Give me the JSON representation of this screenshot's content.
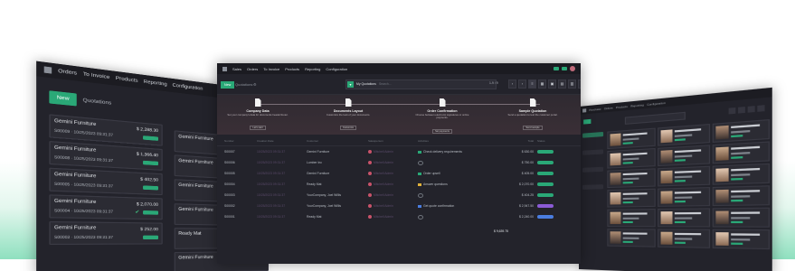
{
  "left": {
    "menu": [
      "Orders",
      "To Invoice",
      "Products",
      "Reporting",
      "Configuration"
    ],
    "new_label": "New",
    "title": "Quotations",
    "cards_col1": [
      {
        "name": "Gemini Furniture",
        "amount": "$ 2,288.30",
        "date": "S00009 · 10/25/2023 09:31:37",
        "badge": true,
        "check": false
      },
      {
        "name": "Gemini Furniture",
        "amount": "$ 1,366.40",
        "date": "S00008 · 10/25/2023 09:31:37",
        "badge": true,
        "check": false
      },
      {
        "name": "Gemini Furniture",
        "amount": "$ 402.50",
        "date": "S00005 · 10/25/2023 09:31:37",
        "badge": true,
        "check": false
      },
      {
        "name": "Gemini Furniture",
        "amount": "$ 2,070.00",
        "date": "S00004 · 10/25/2023 09:31:37",
        "badge": true,
        "check": true
      },
      {
        "name": "Gemini Furniture",
        "amount": "$ 252.00",
        "date": "S00003 · 10/25/2023 09:31:37",
        "badge": true,
        "check": false
      }
    ],
    "cards_col2": [
      {
        "name": "Gemini Furniture"
      },
      {
        "name": "Gemini Furniture"
      },
      {
        "name": "Gemini Furniture"
      },
      {
        "name": "Gemini Furniture"
      },
      {
        "name": "Ready Mat"
      },
      {
        "name": "Gemini Furniture"
      }
    ]
  },
  "center": {
    "menu": [
      "Sales",
      "Orders",
      "To Invoice",
      "Products",
      "Reporting",
      "Configuration"
    ],
    "new_label": "New",
    "title": "Quotations",
    "search_facet": "My Quotations",
    "search_placeholder": "Search...",
    "pager": "1-9 / 9",
    "steps": [
      {
        "title": "Company Data",
        "desc": "Set your company's data for documents header/footer.",
        "btn": "Let's start"
      },
      {
        "title": "Documents Layout",
        "desc": "Customize the look of your documents.",
        "btn": "Customize"
      },
      {
        "title": "Order Confirmation",
        "desc": "Choose between electronic signatures or online payments.",
        "btn": "Set payments"
      },
      {
        "title": "Sample Quotation",
        "desc": "Send a quotation to test the customer portal.",
        "btn": "Send sample"
      }
    ],
    "columns": [
      "Number",
      "Creation Date",
      "Customer",
      "Salesperson",
      "Activities",
      "Total",
      "Status"
    ],
    "rows": [
      {
        "number": "S00007",
        "date": "10/25/2023 09:31:37",
        "customer": "Gemini Furniture",
        "salesperson": "Mitchell Admin",
        "activity": "Check delivery requirements",
        "activity_color": "#2aa877",
        "total": "$ 630.00",
        "status": "Sales Order",
        "status_kind": "green"
      },
      {
        "number": "S00006",
        "date": "10/25/2023 09:31:37",
        "customer": "Lumber Inc",
        "salesperson": "Mitchell Admin",
        "activity": "",
        "activity_color": "#6f747c",
        "total": "$ 750.00",
        "status": "Sales Order",
        "status_kind": "green"
      },
      {
        "number": "S00005",
        "date": "10/25/2023 09:31:37",
        "customer": "Gemini Furniture",
        "salesperson": "Mitchell Admin",
        "activity": "Order upsell",
        "activity_color": "#2aa877",
        "total": "$ 405.00",
        "status": "Sales Order",
        "status_kind": "green"
      },
      {
        "number": "S00004",
        "date": "10/25/2023 09:31:37",
        "customer": "Ready Mat",
        "salesperson": "Mitchell Admin",
        "activity": "Answer questions",
        "activity_color": "#e0b13a",
        "total": "$ 2,070.00",
        "status": "Sales Order",
        "status_kind": "green"
      },
      {
        "number": "S00003",
        "date": "10/25/2023 09:31:37",
        "customer": "YourCompany, Joel Willis",
        "salesperson": "Mitchell Admin",
        "activity": "",
        "activity_color": "#6f747c",
        "total": "$ 404.25",
        "status": "Sales Order",
        "status_kind": "green"
      },
      {
        "number": "S00002",
        "date": "10/25/2023 09:31:37",
        "customer": "YourCompany, Joel Willis",
        "salesperson": "Mitchell Admin",
        "activity": "Get quote confirmation",
        "activity_color": "#4a7de0",
        "total": "$ 2,947.50",
        "status": "Quotation Sent",
        "status_kind": "purple"
      },
      {
        "number": "S00001",
        "date": "10/25/2023 09:31:37",
        "customer": "Ready Mat",
        "salesperson": "Mitchell Admin",
        "activity": "",
        "activity_color": "#6f747c",
        "total": "$ 2,240.00",
        "status": "Quotation",
        "status_kind": "blue"
      }
    ],
    "sum_total": "$ 9,639.75"
  },
  "right": {
    "menu": [
      "Purchase",
      "Orders",
      "Products",
      "Reporting",
      "Configuration"
    ],
    "pager": "1-60 / 64"
  }
}
